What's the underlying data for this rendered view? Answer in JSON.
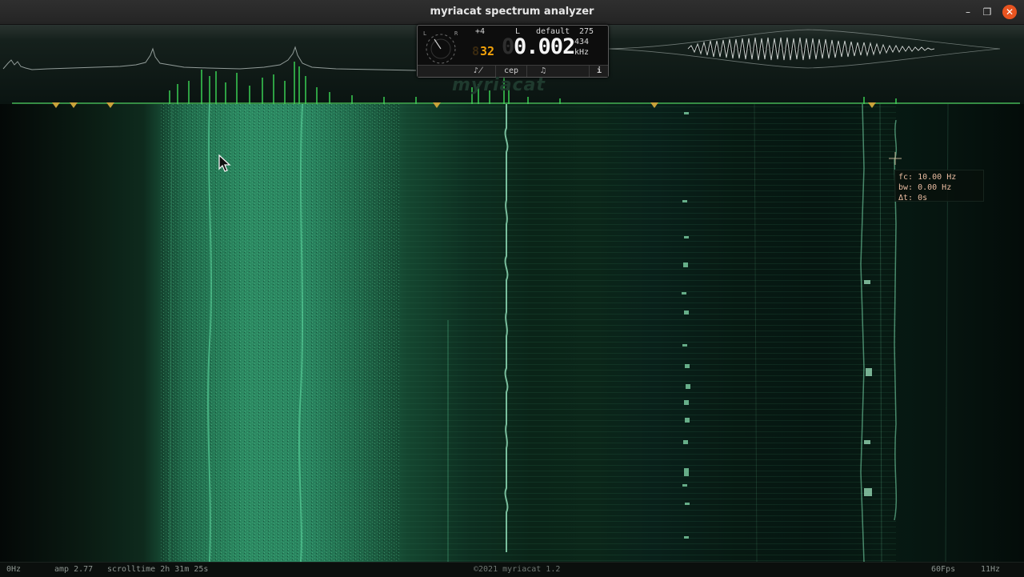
{
  "window": {
    "title": "myriacat spectrum analyzer",
    "controls": {
      "minimize": "–",
      "maximize": "❐",
      "close": "✕"
    }
  },
  "panel": {
    "offset": "+4",
    "channel": "L",
    "preset": "default",
    "count": "275",
    "small_value": "434",
    "unit": "kHz",
    "amber_value": "32",
    "ghost_digit": "8",
    "ghost_zero": "0",
    "reading": "0.002",
    "buttons": {
      "note": "♪̸",
      "cep": "cep",
      "music": "♫",
      "info": "i"
    },
    "dial_labels": {
      "left": "L",
      "right": "R"
    }
  },
  "watermark": "myriacat",
  "tooltip": {
    "fc": "fc: 10.00 Hz",
    "bw": "bw: 0.00 Hz",
    "dt": "Δt: 0s"
  },
  "statusbar": {
    "freq_low": "0Hz",
    "amp": "amp 2.77",
    "scrolltime": "scrolltime 2h 31m 25s",
    "copyright": "©2021 myriacat 1.2",
    "fps": "60Fps",
    "freq_high": "11Hz"
  },
  "colors": {
    "accent_green": "#35d24c",
    "amber": "#f2a20a",
    "marker": "#c9a23a",
    "close_button": "#e95420"
  },
  "icons": {
    "dial": "analog-dial-icon",
    "marker": "triangle-marker-icon",
    "cursor": "mouse-pointer-icon",
    "crosshair": "crosshair-icon"
  }
}
